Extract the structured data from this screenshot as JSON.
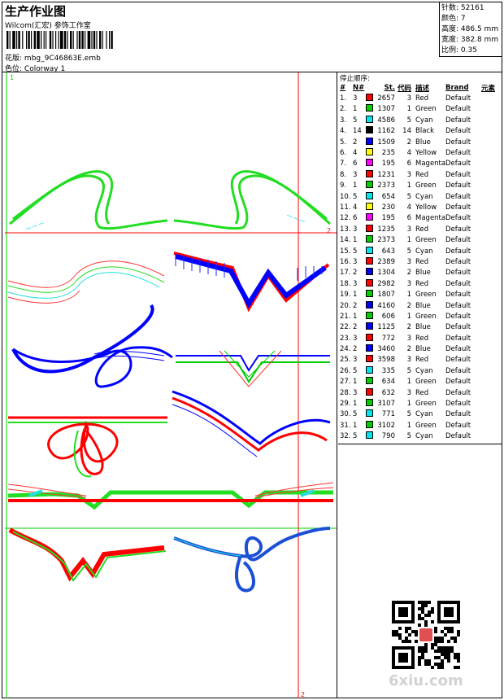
{
  "header": {
    "title": "生产作业图",
    "subtitle": "Wilcom(汇宏) 参饰工作室",
    "file_label": "花版:",
    "file_value": "mbg_9C46863E.emb",
    "colorway_label": "色位:",
    "colorway_value": "Colorway 1"
  },
  "stats": {
    "stitches_label": "针数:",
    "stitches_value": "52161",
    "colors_label": "颜色:",
    "colors_value": "7",
    "height_label": "高度:",
    "height_value": "486.5 mm",
    "width_label": "宽度:",
    "width_value": "382.8 mm",
    "scale_label": "比例:",
    "scale_value": "0.35"
  },
  "canvas": {
    "corner_mark": "1",
    "horiz_guide_mark": "2",
    "vert_guide_mark": "2"
  },
  "table": {
    "caption": "停止顺序:",
    "headers": {
      "n": "#",
      "needle": "N#",
      "st": "St.",
      "code": "代码",
      "desc": "描述",
      "brand": "Brand",
      "element": "元素"
    },
    "rows": [
      {
        "n": "1.",
        "needle": "3",
        "color": "#ff0000",
        "st": "2657",
        "code": "3",
        "desc": "Red",
        "brand": "Default"
      },
      {
        "n": "2.",
        "needle": "1",
        "color": "#00cc00",
        "st": "1307",
        "code": "1",
        "desc": "Green",
        "brand": "Default"
      },
      {
        "n": "3.",
        "needle": "5",
        "color": "#00e5ee",
        "st": "4586",
        "code": "5",
        "desc": "Cyan",
        "brand": "Default"
      },
      {
        "n": "4.",
        "needle": "14",
        "color": "#000000",
        "st": "1162",
        "code": "14",
        "desc": "Black",
        "brand": "Default"
      },
      {
        "n": "5.",
        "needle": "2",
        "color": "#0000ff",
        "st": "1509",
        "code": "2",
        "desc": "Blue",
        "brand": "Default"
      },
      {
        "n": "6.",
        "needle": "4",
        "color": "#ffff00",
        "st": "235",
        "code": "4",
        "desc": "Yellow",
        "brand": "Default"
      },
      {
        "n": "7.",
        "needle": "6",
        "color": "#ff00ff",
        "st": "195",
        "code": "6",
        "desc": "Magenta",
        "brand": "Default"
      },
      {
        "n": "8.",
        "needle": "3",
        "color": "#ff0000",
        "st": "1231",
        "code": "3",
        "desc": "Red",
        "brand": "Default"
      },
      {
        "n": "9.",
        "needle": "1",
        "color": "#00cc00",
        "st": "2373",
        "code": "1",
        "desc": "Green",
        "brand": "Default"
      },
      {
        "n": "10.",
        "needle": "5",
        "color": "#00e5ee",
        "st": "654",
        "code": "5",
        "desc": "Cyan",
        "brand": "Default"
      },
      {
        "n": "11.",
        "needle": "4",
        "color": "#ffff00",
        "st": "230",
        "code": "4",
        "desc": "Yellow",
        "brand": "Default"
      },
      {
        "n": "12.",
        "needle": "6",
        "color": "#ff00ff",
        "st": "195",
        "code": "6",
        "desc": "Magenta",
        "brand": "Default"
      },
      {
        "n": "13.",
        "needle": "3",
        "color": "#ff0000",
        "st": "1235",
        "code": "3",
        "desc": "Red",
        "brand": "Default"
      },
      {
        "n": "14.",
        "needle": "1",
        "color": "#00cc00",
        "st": "2373",
        "code": "1",
        "desc": "Green",
        "brand": "Default"
      },
      {
        "n": "15.",
        "needle": "5",
        "color": "#00e5ee",
        "st": "643",
        "code": "5",
        "desc": "Cyan",
        "brand": "Default"
      },
      {
        "n": "16.",
        "needle": "3",
        "color": "#ff0000",
        "st": "2389",
        "code": "3",
        "desc": "Red",
        "brand": "Default"
      },
      {
        "n": "17.",
        "needle": "2",
        "color": "#0000ff",
        "st": "1304",
        "code": "2",
        "desc": "Blue",
        "brand": "Default"
      },
      {
        "n": "18.",
        "needle": "3",
        "color": "#ff0000",
        "st": "2982",
        "code": "3",
        "desc": "Red",
        "brand": "Default"
      },
      {
        "n": "19.",
        "needle": "1",
        "color": "#00cc00",
        "st": "1807",
        "code": "1",
        "desc": "Green",
        "brand": "Default"
      },
      {
        "n": "20.",
        "needle": "2",
        "color": "#0000ff",
        "st": "4160",
        "code": "2",
        "desc": "Blue",
        "brand": "Default"
      },
      {
        "n": "21.",
        "needle": "1",
        "color": "#00cc00",
        "st": "606",
        "code": "1",
        "desc": "Green",
        "brand": "Default"
      },
      {
        "n": "22.",
        "needle": "2",
        "color": "#0000ff",
        "st": "1125",
        "code": "2",
        "desc": "Blue",
        "brand": "Default"
      },
      {
        "n": "23.",
        "needle": "3",
        "color": "#ff0000",
        "st": "772",
        "code": "3",
        "desc": "Red",
        "brand": "Default"
      },
      {
        "n": "24.",
        "needle": "2",
        "color": "#0000ff",
        "st": "3460",
        "code": "2",
        "desc": "Blue",
        "brand": "Default"
      },
      {
        "n": "25.",
        "needle": "3",
        "color": "#ff0000",
        "st": "3598",
        "code": "3",
        "desc": "Red",
        "brand": "Default"
      },
      {
        "n": "26.",
        "needle": "5",
        "color": "#00e5ee",
        "st": "335",
        "code": "5",
        "desc": "Cyan",
        "brand": "Default"
      },
      {
        "n": "27.",
        "needle": "1",
        "color": "#00cc00",
        "st": "634",
        "code": "1",
        "desc": "Green",
        "brand": "Default"
      },
      {
        "n": "28.",
        "needle": "3",
        "color": "#ff0000",
        "st": "632",
        "code": "3",
        "desc": "Red",
        "brand": "Default"
      },
      {
        "n": "29.",
        "needle": "1",
        "color": "#00cc00",
        "st": "3107",
        "code": "1",
        "desc": "Green",
        "brand": "Default"
      },
      {
        "n": "30.",
        "needle": "5",
        "color": "#00e5ee",
        "st": "771",
        "code": "5",
        "desc": "Cyan",
        "brand": "Default"
      },
      {
        "n": "31.",
        "needle": "1",
        "color": "#00cc00",
        "st": "3102",
        "code": "1",
        "desc": "Green",
        "brand": "Default"
      },
      {
        "n": "32.",
        "needle": "5",
        "color": "#00e5ee",
        "st": "790",
        "code": "5",
        "desc": "Cyan",
        "brand": "Default"
      }
    ]
  },
  "watermark": "6xiu.com",
  "colors": {
    "guide_red": "#ff0000",
    "guide_green": "#00cc00",
    "blue": "#0000ff"
  }
}
